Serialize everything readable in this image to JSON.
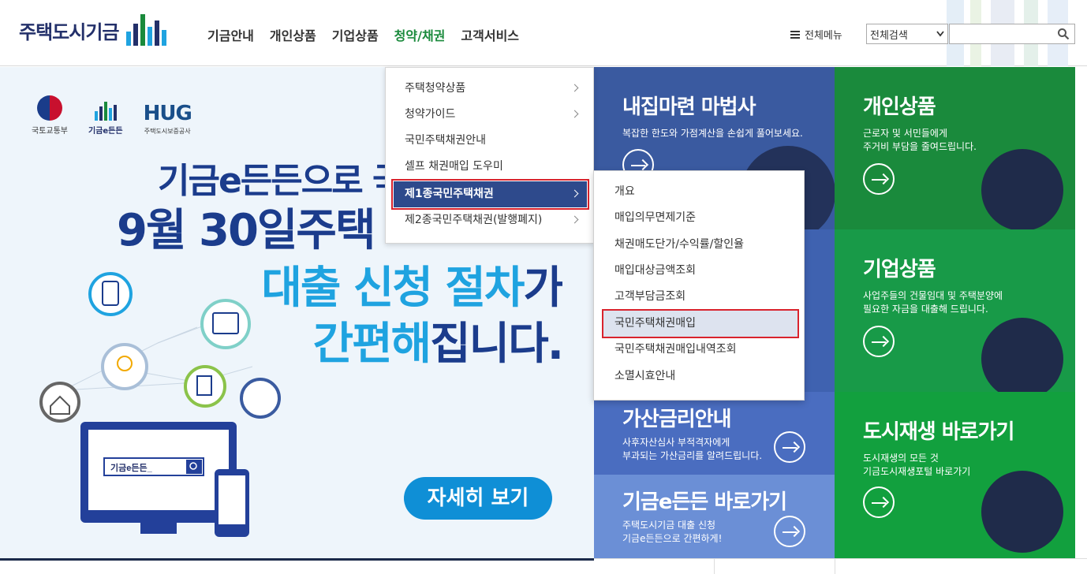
{
  "header": {
    "logo_text": "주택도시기금",
    "gnb": [
      "기금안내",
      "개인상품",
      "기업상품",
      "청약/채권",
      "고객서비스"
    ],
    "active_gnb_index": 3,
    "all_menu_label": "전체메뉴",
    "search_select_value": "전체검색",
    "search_input_value": "",
    "colors": {
      "active": "#1a8a3c",
      "logo": "#23306a"
    }
  },
  "banner": {
    "gov_logo_label": "국토교통부",
    "fund_logo_label": "기금e든든",
    "hug_label": "HUG",
    "hug_sub": "주택도시보증공사",
    "line1": "기금e든든으로 국민",
    "line2": "9월 30일주택",
    "line3_a": "대출 신청 절차",
    "line3_b": "가",
    "line4_a": "간편해",
    "line4_b": "집니다.",
    "search_box_text": "기금e든든_",
    "cta_label": "자세히 보기"
  },
  "tiles": {
    "magic": {
      "title": "내집마련 마법사",
      "desc": "복잡한 한도와 가점계산을 손쉽게 풀어보세요."
    },
    "personal": {
      "title": "개인상품",
      "desc": "근로자 및 서민들에게\n주거비 부담을 줄여드립니다."
    },
    "business": {
      "title": "기업상품",
      "desc": "사업주들의 건물임대 및 주택분양에\n필요한 자금을 대출해 드립니다."
    },
    "surcharge": {
      "title": "가산금리안내",
      "desc": "사후자산심사 부적격자에게\n부과되는 가산금리를 알려드립니다."
    },
    "regen": {
      "title": "도시재생 바로가기",
      "desc": "도시재생의 모든 것\n기금도시재생포털 바로가기"
    },
    "egood": {
      "title": "기금e든든 바로가기",
      "desc": "주택도시기금 대출 신청\n기금e든든으로 간편하게!"
    }
  },
  "menu1": {
    "items": [
      {
        "label": "주택청약상품",
        "chevron": true
      },
      {
        "label": "청약가이드",
        "chevron": true
      },
      {
        "label": "국민주택채권안내",
        "chevron": false
      },
      {
        "label": "셀프 채권매입 도우미",
        "chevron": false
      },
      {
        "label": "제1종국민주택채권",
        "chevron": true
      },
      {
        "label": "제2종국민주택채권(발행폐지)",
        "chevron": true
      }
    ],
    "selected_index": 4
  },
  "menu2": {
    "items": [
      "개요",
      "매입의무면제기준",
      "채권매도단가/수익률/할인율",
      "매입대상금액조회",
      "고객부담금조회",
      "국민주택채권매입",
      "국민주택채권매입내역조회",
      "소멸시효안내"
    ],
    "selected_index": 5
  }
}
